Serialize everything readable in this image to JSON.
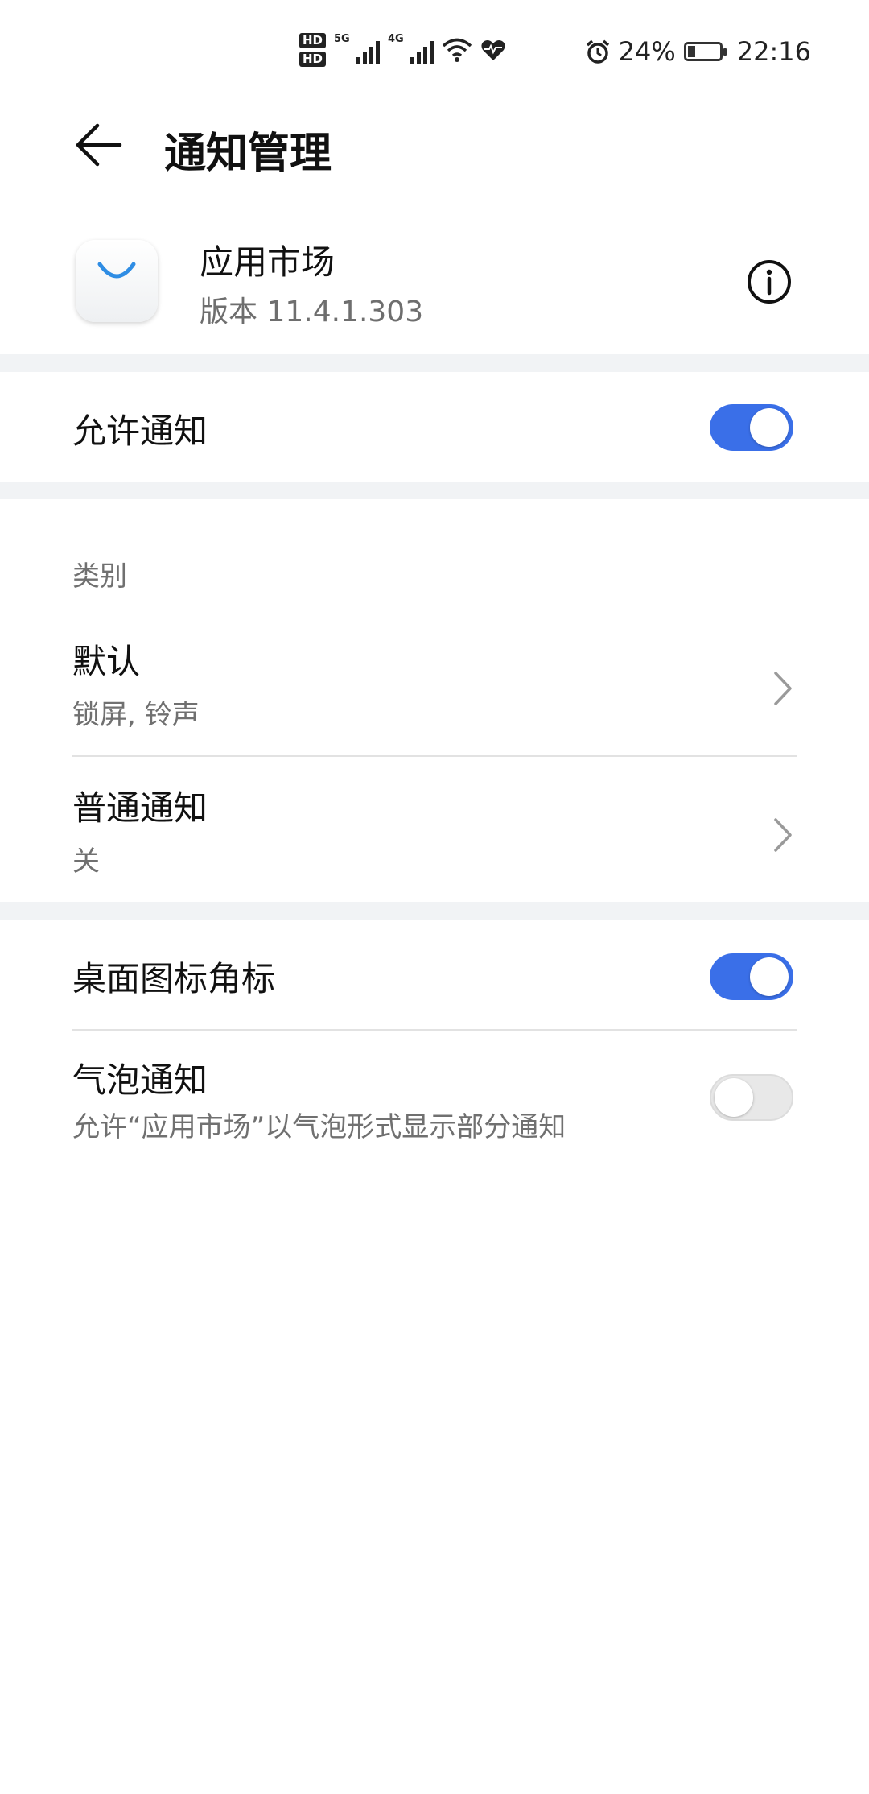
{
  "status_bar": {
    "hd1": "HD",
    "hd2": "HD",
    "signal1_tag": "5G",
    "signal2_tag": "4G",
    "battery_percent": "24%",
    "time": "22:16",
    "icons": [
      "hd-icon",
      "signal-5g-icon",
      "signal-4g-icon",
      "wifi-icon",
      "health-icon",
      "alarm-icon",
      "battery-charging-icon"
    ]
  },
  "header": {
    "title": "通知管理"
  },
  "app": {
    "name": "应用市场",
    "version": "版本 11.4.1.303"
  },
  "allow_notifications": {
    "label": "允许通知",
    "enabled": true
  },
  "categories": {
    "section_label": "类别",
    "items": [
      {
        "title": "默认",
        "subtitle": "锁屏, 铃声"
      },
      {
        "title": "普通通知",
        "subtitle": "关"
      }
    ]
  },
  "badge": {
    "label": "桌面图标角标",
    "enabled": true
  },
  "bubble": {
    "label": "气泡通知",
    "description": "允许“应用市场”以气泡形式显示部分通知",
    "enabled": false
  },
  "colors": {
    "accent": "#3a6fe8",
    "band": "#f1f3f5",
    "secondary_text": "#707070"
  }
}
